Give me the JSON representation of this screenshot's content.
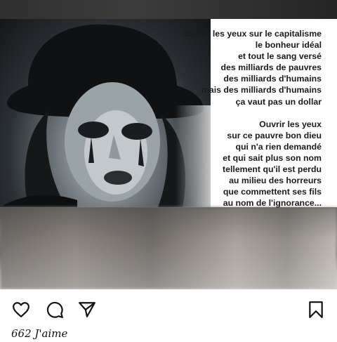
{
  "post": {
    "poem": [
      "Ouvrir les yeux sur le capitalisme",
      "le bonheur idéal",
      "et tout le sang versé",
      "des milliards de pauvres",
      "des milliards d'humains",
      "mais des milliards d'humains",
      "ça vaut pas un dollar",
      "",
      "Ouvrir les yeux",
      "sur ce pauvre bon dieu",
      "qui n'a rien demandé",
      "et qui sait plus son nom",
      "tellement qu'il est perdu",
      "au milieu des horreurs",
      "que commettent ses fils",
      "au nom de l'ignorance..."
    ]
  },
  "actions": {
    "like_icon": "heart-icon",
    "comment_icon": "comment-icon",
    "share_icon": "send-icon",
    "save_icon": "bookmark-icon"
  },
  "likes_text": "662 J'aime"
}
